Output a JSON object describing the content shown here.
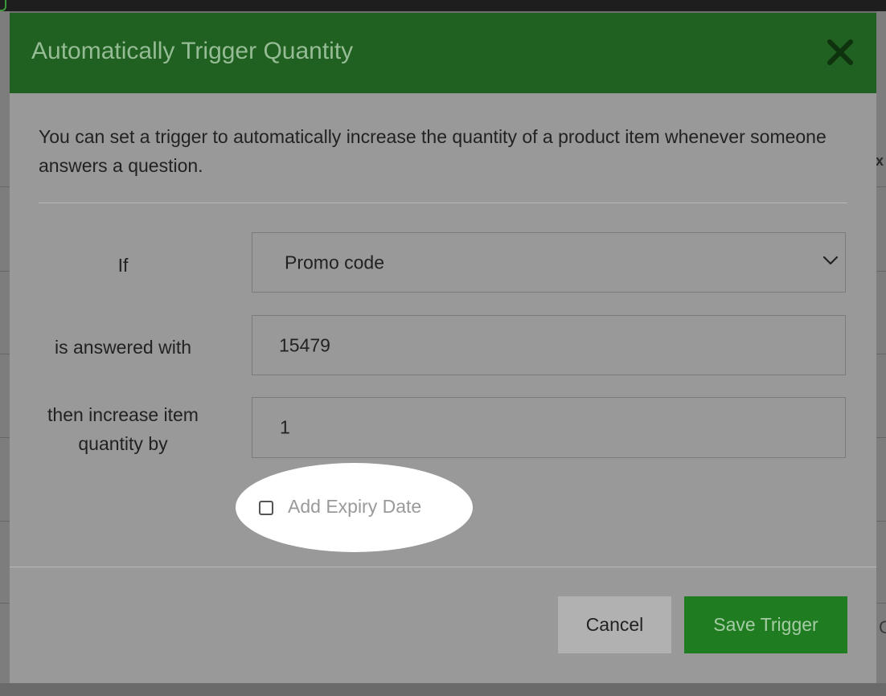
{
  "modal": {
    "title": "Automatically Trigger Quantity",
    "description": "You can set a trigger to automatically increase the quantity of a product item whenever someone answers a question."
  },
  "form": {
    "if_label": "If",
    "question_select": {
      "selected": "Promo code"
    },
    "answered_label": "is answered with",
    "answer_value": "15479",
    "increase_label": "then increase item quantity by",
    "quantity_value": "1",
    "expiry_checkbox": {
      "label": "Add Expiry Date",
      "checked": false
    }
  },
  "buttons": {
    "cancel_label": "Cancel",
    "save_label": "Save Trigger"
  },
  "icons": {
    "close": "close-icon",
    "dropdown": "chevron-down-icon"
  },
  "colors": {
    "header": "#206020",
    "save_button": "#207c20",
    "cancel_button": "#b1b1b1"
  }
}
